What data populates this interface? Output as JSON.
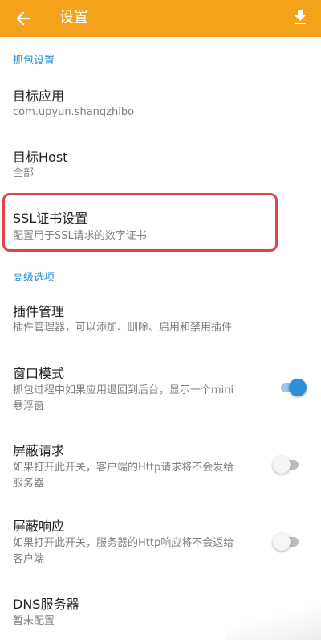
{
  "appbar": {
    "title": "设置",
    "back_icon": "arrow-back-icon",
    "download_icon": "download-icon",
    "background": "#F5A21B"
  },
  "sections": {
    "capture": "抓包设置",
    "advanced": "高级选项"
  },
  "items": {
    "target_app": {
      "title": "目标应用",
      "summary": "com.upyun.shangzhibo"
    },
    "target_host": {
      "title": "目标Host",
      "summary": "全部"
    },
    "ssl": {
      "title": "SSL证书设置",
      "summary": "配置用于SSL请求的数字证书"
    },
    "plugins": {
      "title": "插件管理",
      "summary": "插件管理器，可以添加、删除、启用和禁用插件"
    },
    "window_mode": {
      "title": "窗口模式",
      "summary_line1": "抓包过程中如果应用退回到后台，显示一个mini",
      "summary_line2": "悬浮窗",
      "enabled": true
    },
    "block_request": {
      "title": "屏蔽请求",
      "summary_line1": "如果打开此开关，客户端的Http请求将不会发给",
      "summary_line2": "服务器",
      "enabled": false
    },
    "block_response": {
      "title": "屏蔽响应",
      "summary_line1": "如果打开此开关，服务器的Http响应将不会返给",
      "summary_line2": "客户端",
      "enabled": false
    },
    "dns": {
      "title": "DNS服务器",
      "summary": "暂未配置"
    }
  },
  "colors": {
    "accent": "#1D8FC9",
    "toggle_on": "#2C8FD8",
    "highlight_border": "#E0444A"
  }
}
